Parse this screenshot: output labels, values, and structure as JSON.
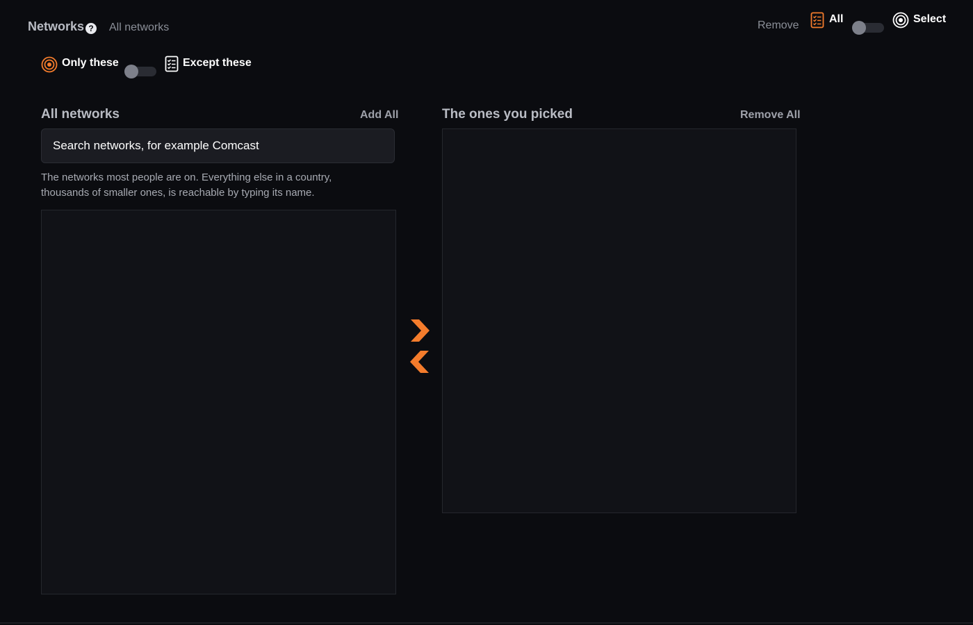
{
  "header": {
    "title": "Networks",
    "help_icon": "question-circle-icon",
    "subtitle": "All networks",
    "remove_label": "Remove",
    "all_label": "All",
    "select_label": "Select"
  },
  "mode": {
    "only_label": "Only these",
    "except_label": "Except these",
    "toggle_on": false
  },
  "left_panel": {
    "title": "All networks",
    "action_label": "Add All",
    "search_placeholder": "Search networks, for example Comcast",
    "hint": "The networks most people are on. Everything else in a country, thousands of smaller ones, is reachable by typing its name."
  },
  "right_panel": {
    "title": "The ones you picked",
    "action_label": "Remove All"
  },
  "colors": {
    "accent": "#f47c2c",
    "background": "#0b0c10",
    "panel": "#111217"
  }
}
